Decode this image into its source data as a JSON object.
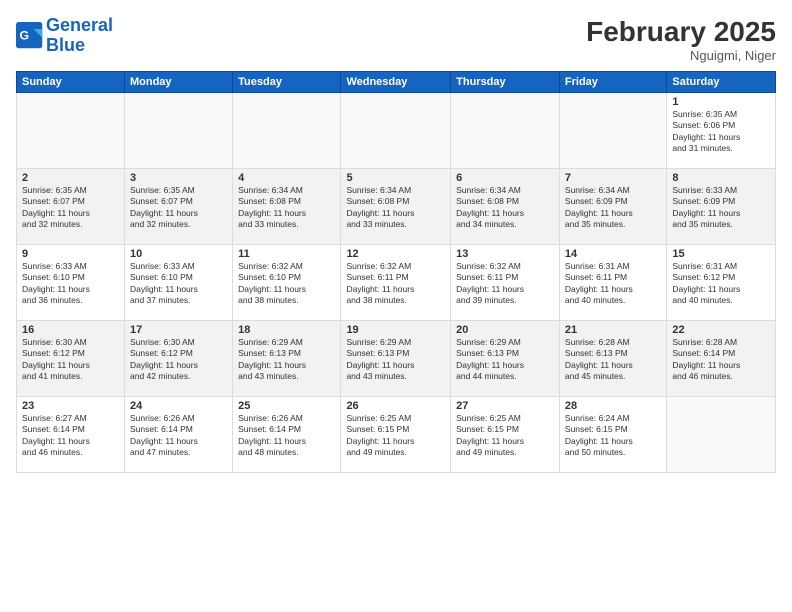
{
  "header": {
    "logo_line1": "General",
    "logo_line2": "Blue",
    "month_title": "February 2025",
    "location": "Nguigmi, Niger"
  },
  "days_of_week": [
    "Sunday",
    "Monday",
    "Tuesday",
    "Wednesday",
    "Thursday",
    "Friday",
    "Saturday"
  ],
  "weeks": [
    {
      "shaded": false,
      "days": [
        {
          "num": "",
          "info": ""
        },
        {
          "num": "",
          "info": ""
        },
        {
          "num": "",
          "info": ""
        },
        {
          "num": "",
          "info": ""
        },
        {
          "num": "",
          "info": ""
        },
        {
          "num": "",
          "info": ""
        },
        {
          "num": "1",
          "info": "Sunrise: 6:35 AM\nSunset: 6:06 PM\nDaylight: 11 hours\nand 31 minutes."
        }
      ]
    },
    {
      "shaded": true,
      "days": [
        {
          "num": "2",
          "info": "Sunrise: 6:35 AM\nSunset: 6:07 PM\nDaylight: 11 hours\nand 32 minutes."
        },
        {
          "num": "3",
          "info": "Sunrise: 6:35 AM\nSunset: 6:07 PM\nDaylight: 11 hours\nand 32 minutes."
        },
        {
          "num": "4",
          "info": "Sunrise: 6:34 AM\nSunset: 6:08 PM\nDaylight: 11 hours\nand 33 minutes."
        },
        {
          "num": "5",
          "info": "Sunrise: 6:34 AM\nSunset: 6:08 PM\nDaylight: 11 hours\nand 33 minutes."
        },
        {
          "num": "6",
          "info": "Sunrise: 6:34 AM\nSunset: 6:08 PM\nDaylight: 11 hours\nand 34 minutes."
        },
        {
          "num": "7",
          "info": "Sunrise: 6:34 AM\nSunset: 6:09 PM\nDaylight: 11 hours\nand 35 minutes."
        },
        {
          "num": "8",
          "info": "Sunrise: 6:33 AM\nSunset: 6:09 PM\nDaylight: 11 hours\nand 35 minutes."
        }
      ]
    },
    {
      "shaded": false,
      "days": [
        {
          "num": "9",
          "info": "Sunrise: 6:33 AM\nSunset: 6:10 PM\nDaylight: 11 hours\nand 36 minutes."
        },
        {
          "num": "10",
          "info": "Sunrise: 6:33 AM\nSunset: 6:10 PM\nDaylight: 11 hours\nand 37 minutes."
        },
        {
          "num": "11",
          "info": "Sunrise: 6:32 AM\nSunset: 6:10 PM\nDaylight: 11 hours\nand 38 minutes."
        },
        {
          "num": "12",
          "info": "Sunrise: 6:32 AM\nSunset: 6:11 PM\nDaylight: 11 hours\nand 38 minutes."
        },
        {
          "num": "13",
          "info": "Sunrise: 6:32 AM\nSunset: 6:11 PM\nDaylight: 11 hours\nand 39 minutes."
        },
        {
          "num": "14",
          "info": "Sunrise: 6:31 AM\nSunset: 6:11 PM\nDaylight: 11 hours\nand 40 minutes."
        },
        {
          "num": "15",
          "info": "Sunrise: 6:31 AM\nSunset: 6:12 PM\nDaylight: 11 hours\nand 40 minutes."
        }
      ]
    },
    {
      "shaded": true,
      "days": [
        {
          "num": "16",
          "info": "Sunrise: 6:30 AM\nSunset: 6:12 PM\nDaylight: 11 hours\nand 41 minutes."
        },
        {
          "num": "17",
          "info": "Sunrise: 6:30 AM\nSunset: 6:12 PM\nDaylight: 11 hours\nand 42 minutes."
        },
        {
          "num": "18",
          "info": "Sunrise: 6:29 AM\nSunset: 6:13 PM\nDaylight: 11 hours\nand 43 minutes."
        },
        {
          "num": "19",
          "info": "Sunrise: 6:29 AM\nSunset: 6:13 PM\nDaylight: 11 hours\nand 43 minutes."
        },
        {
          "num": "20",
          "info": "Sunrise: 6:29 AM\nSunset: 6:13 PM\nDaylight: 11 hours\nand 44 minutes."
        },
        {
          "num": "21",
          "info": "Sunrise: 6:28 AM\nSunset: 6:13 PM\nDaylight: 11 hours\nand 45 minutes."
        },
        {
          "num": "22",
          "info": "Sunrise: 6:28 AM\nSunset: 6:14 PM\nDaylight: 11 hours\nand 46 minutes."
        }
      ]
    },
    {
      "shaded": false,
      "days": [
        {
          "num": "23",
          "info": "Sunrise: 6:27 AM\nSunset: 6:14 PM\nDaylight: 11 hours\nand 46 minutes."
        },
        {
          "num": "24",
          "info": "Sunrise: 6:26 AM\nSunset: 6:14 PM\nDaylight: 11 hours\nand 47 minutes."
        },
        {
          "num": "25",
          "info": "Sunrise: 6:26 AM\nSunset: 6:14 PM\nDaylight: 11 hours\nand 48 minutes."
        },
        {
          "num": "26",
          "info": "Sunrise: 6:25 AM\nSunset: 6:15 PM\nDaylight: 11 hours\nand 49 minutes."
        },
        {
          "num": "27",
          "info": "Sunrise: 6:25 AM\nSunset: 6:15 PM\nDaylight: 11 hours\nand 49 minutes."
        },
        {
          "num": "28",
          "info": "Sunrise: 6:24 AM\nSunset: 6:15 PM\nDaylight: 11 hours\nand 50 minutes."
        },
        {
          "num": "",
          "info": ""
        }
      ]
    }
  ]
}
